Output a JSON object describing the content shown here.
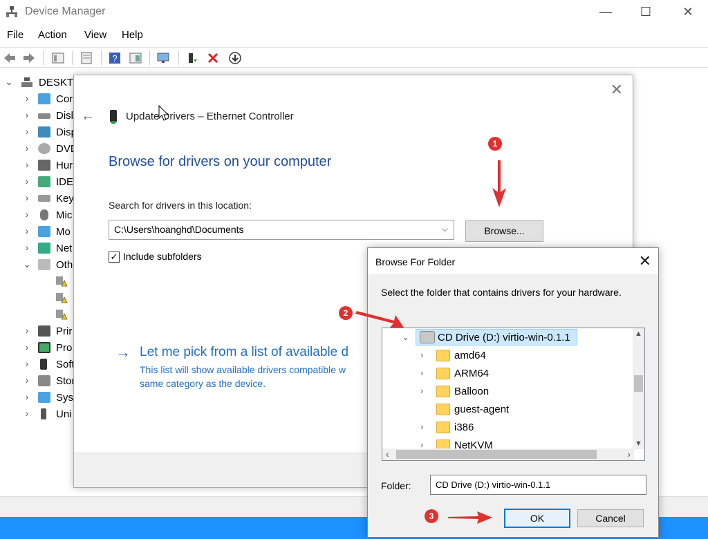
{
  "window": {
    "title": "Device Manager",
    "controls": {
      "minimize": "—",
      "maximize": "☐",
      "close": "✕"
    }
  },
  "menu": [
    "File",
    "Action",
    "View",
    "Help"
  ],
  "toolbar_icons": [
    "back-icon",
    "forward-icon",
    "properties-icon",
    "scan-icon",
    "help-icon",
    "view-icon",
    "monitor-icon",
    "update-driver-icon",
    "uninstall-icon",
    "download-icon"
  ],
  "tree": {
    "root": "DESKTO",
    "items": [
      "Cor",
      "Disl",
      "Disp",
      "DVD",
      "Hur",
      "IDE",
      "Key",
      "Mic",
      "Mo",
      "Net",
      "Oth",
      "",
      "",
      "",
      "Prir",
      "Pro",
      "Soft",
      "Stor",
      "Syst",
      "Uni"
    ]
  },
  "update_dialog": {
    "header": "Update Drivers – Ethernet Controller",
    "heading": "Browse for drivers on your computer",
    "search_label": "Search for drivers in this location:",
    "path": "C:\\Users\\hoanghd\\Documents",
    "browse_button": "Browse...",
    "include_subfolders": "Include subfolders",
    "pick_title": "Let me pick from a list of available d",
    "pick_description": "This list will show available drivers compatible w same category as the device."
  },
  "browse_dialog": {
    "title": "Browse For Folder",
    "instruction": "Select the folder that contains drivers for your hardware.",
    "tree": [
      {
        "label": "CD Drive (D:) virtio-win-0.1.1",
        "expanded": true,
        "selected": true
      },
      {
        "label": "amd64"
      },
      {
        "label": "ARM64"
      },
      {
        "label": "Balloon"
      },
      {
        "label": "guest-agent"
      },
      {
        "label": "i386"
      },
      {
        "label": "NetKVM"
      }
    ],
    "folder_label": "Folder:",
    "folder_value": "CD Drive (D:) virtio-win-0.1.1",
    "ok_button": "OK",
    "cancel_button": "Cancel"
  },
  "annotations": {
    "step1": "1",
    "step2": "2",
    "step3": "3",
    "color": "#e03030"
  }
}
